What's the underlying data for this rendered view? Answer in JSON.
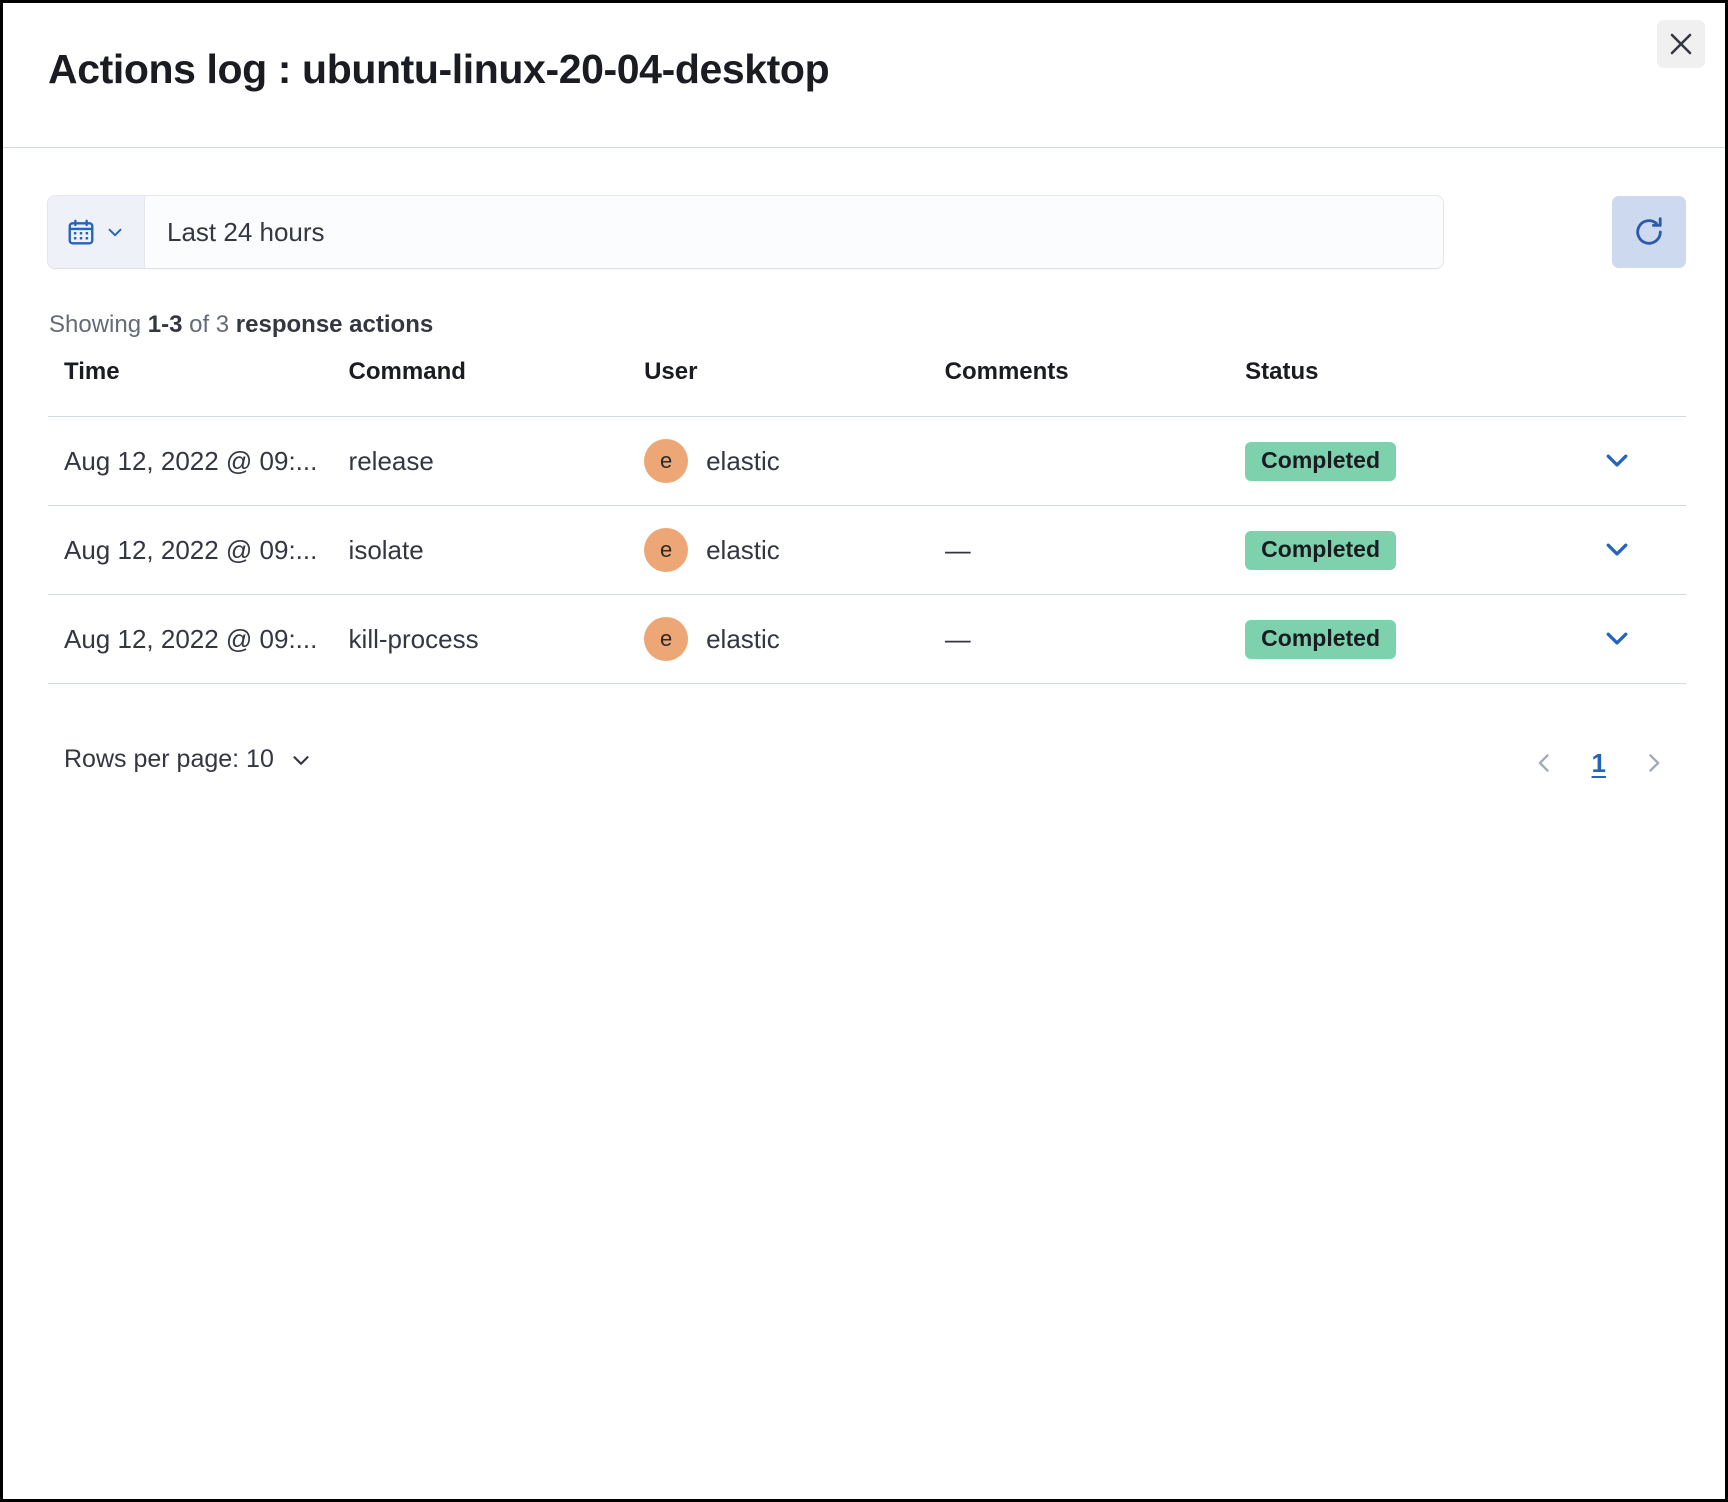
{
  "header": {
    "title": "Actions log : ubuntu-linux-20-04-desktop",
    "close_icon": "close-icon"
  },
  "toolbar": {
    "calendar_icon": "calendar-icon",
    "quick_select_chevron_icon": "chevron-down-icon",
    "date_range_value": "Last 24 hours",
    "refresh_icon": "refresh-icon"
  },
  "summary": {
    "prefix": "Showing ",
    "range": "1-3",
    "middle": " of 3 ",
    "entity": "response actions"
  },
  "table": {
    "columns": [
      "Time",
      "Command",
      "User",
      "Comments",
      "Status"
    ],
    "rows": [
      {
        "time": "Aug 12, 2022 @ 09:...",
        "command": "release",
        "user_initial": "e",
        "user": "elastic",
        "comments": "",
        "status": "Completed",
        "expand_icon": "chevron-down-icon"
      },
      {
        "time": "Aug 12, 2022 @ 09:...",
        "command": "isolate",
        "user_initial": "e",
        "user": "elastic",
        "comments": "—",
        "status": "Completed",
        "expand_icon": "chevron-down-icon"
      },
      {
        "time": "Aug 12, 2022 @ 09:...",
        "command": "kill-process",
        "user_initial": "e",
        "user": "elastic",
        "comments": "—",
        "status": "Completed",
        "expand_icon": "chevron-down-icon"
      }
    ]
  },
  "footer": {
    "rows_per_page_label": "Rows per page: 10",
    "rows_per_page_chevron_icon": "chevron-down-icon",
    "prev_page_icon": "chevron-left-icon",
    "current_page": "1",
    "next_page_icon": "chevron-right-icon"
  },
  "colors": {
    "accent_blue": "#2563c0",
    "badge_green": "#7dd2ad",
    "avatar_orange": "#eda776",
    "border": "#d3dae6"
  }
}
